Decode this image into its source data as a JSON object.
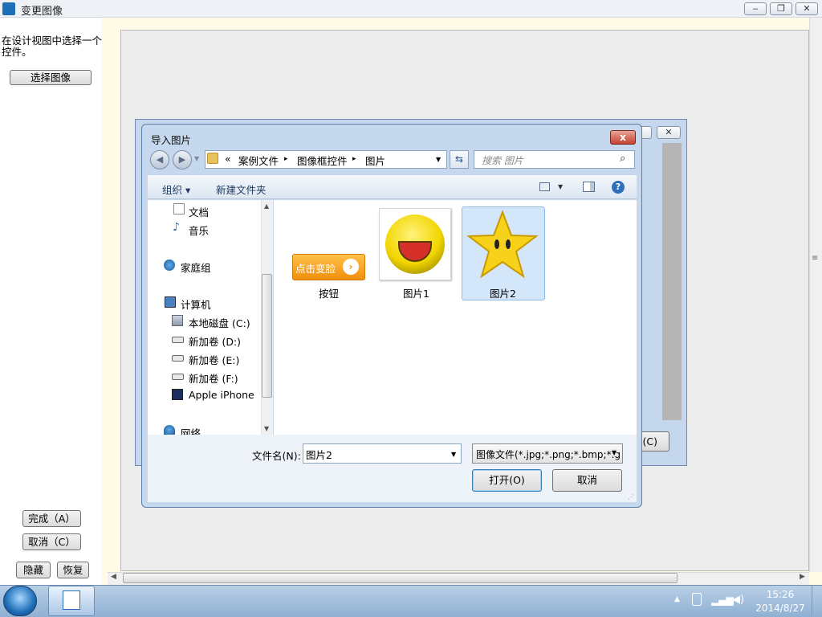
{
  "window": {
    "title": "变更图像"
  },
  "left_panel": {
    "hint": "在设计视图中选择一个控件。",
    "select_image": "选择图像",
    "finish": "完成（A）",
    "cancel": "取消（C）",
    "hide": "隐藏",
    "restore": "恢复"
  },
  "background_dialog": {
    "button_partial": "(C)"
  },
  "dialog": {
    "title": "导入图片",
    "close_symbol": "x",
    "address": {
      "prefix": "«",
      "crumbs": [
        "案例文件",
        "图像框控件",
        "图片"
      ],
      "sep": "▸"
    },
    "search_placeholder": "搜索 图片",
    "toolbar": {
      "organize": "组织 ▾",
      "new_folder": "新建文件夹"
    },
    "nav_items": {
      "documents": "文档",
      "music": "音乐",
      "homegroup": "家庭组",
      "computer": "计算机",
      "drive_c": "本地磁盘 (C:)",
      "drive_d": "新加卷 (D:)",
      "drive_e": "新加卷 (E:)",
      "drive_f": "新加卷 (F:)",
      "iphone": "Apple iPhone",
      "network": "网络"
    },
    "files": {
      "button": {
        "name": "按钮",
        "thumb_text": "点击变脸"
      },
      "pic1": {
        "name": "图片1"
      },
      "pic2": {
        "name": "图片2",
        "selected": true
      }
    },
    "filename_label": "文件名(N):",
    "filename_value": "图片2",
    "filetype_value": "图像文件(*.jpg;*.png;*.bmp;*.g",
    "open_button": "打开(O)",
    "cancel_button": "取消"
  },
  "taskbar": {
    "time": "15:26",
    "date": "2014/8/27"
  },
  "colors": {
    "accent": "#2f6ebd",
    "selection": "#d4e6fa",
    "button_thumb": "#f5a623"
  }
}
